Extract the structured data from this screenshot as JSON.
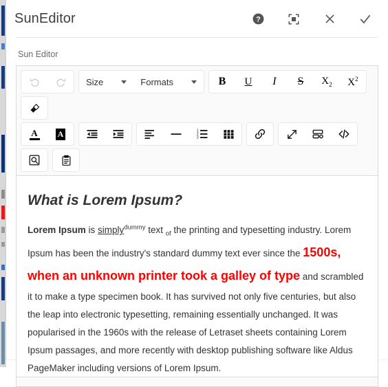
{
  "window": {
    "title": "SunEditor",
    "header_actions": [
      {
        "name": "help-icon",
        "label": "Help"
      },
      {
        "name": "fullscreen-icon",
        "label": "Full screen"
      },
      {
        "name": "close-icon",
        "label": "Close"
      },
      {
        "name": "confirm-icon",
        "label": "Submit"
      }
    ]
  },
  "field": {
    "label": "Sun Editor"
  },
  "toolbar": {
    "groups_row1": [
      {
        "name": "history-group",
        "buttons": [
          {
            "name": "undo-button",
            "icon": "undo-icon",
            "label": "Undo",
            "disabled": true
          },
          {
            "name": "redo-button",
            "icon": "redo-icon",
            "label": "Redo",
            "disabled": true
          }
        ]
      },
      {
        "name": "dropdown-group",
        "buttons": [
          {
            "name": "font-size-select",
            "icon": "chevron-down-icon",
            "label": "Size",
            "disabled": false
          },
          {
            "name": "formats-select",
            "icon": "chevron-down-icon",
            "label": "Formats",
            "disabled": false
          }
        ]
      },
      {
        "name": "text-style-group",
        "buttons": [
          {
            "name": "bold-button",
            "icon": "bold-icon",
            "label": "B",
            "disabled": false
          },
          {
            "name": "underline-button",
            "icon": "underline-icon",
            "label": "U",
            "disabled": false
          },
          {
            "name": "italic-button",
            "icon": "italic-icon",
            "label": "I",
            "disabled": false
          },
          {
            "name": "strikethrough-button",
            "icon": "strikethrough-icon",
            "label": "S",
            "disabled": false
          },
          {
            "name": "subscript-button",
            "icon": "subscript-icon",
            "label": "X",
            "sub": "2",
            "disabled": false
          },
          {
            "name": "superscript-button",
            "icon": "superscript-icon",
            "label": "X",
            "sup": "2",
            "disabled": false
          }
        ]
      },
      {
        "name": "remove-format-group",
        "buttons": [
          {
            "name": "remove-format-button",
            "icon": "eraser-icon",
            "label": "Remove Format",
            "disabled": false
          }
        ]
      }
    ],
    "groups_row2": [
      {
        "name": "color-group",
        "buttons": [
          {
            "name": "font-color-button",
            "icon": "font-color-icon",
            "label": "A",
            "disabled": false
          },
          {
            "name": "highlight-color-button",
            "icon": "highlight-color-icon",
            "label": "A",
            "disabled": false
          }
        ]
      },
      {
        "name": "indent-group",
        "buttons": [
          {
            "name": "outdent-button",
            "icon": "outdent-icon",
            "label": "Outdent",
            "disabled": false
          },
          {
            "name": "indent-button",
            "icon": "indent-icon",
            "label": "Indent",
            "disabled": false
          }
        ]
      },
      {
        "name": "block-group",
        "buttons": [
          {
            "name": "align-button",
            "icon": "align-left-icon",
            "label": "Align",
            "disabled": false
          },
          {
            "name": "horizontal-rule-button",
            "icon": "horizontal-line-icon",
            "label": "Horizontal line",
            "disabled": false
          },
          {
            "name": "list-button",
            "icon": "ordered-list-icon",
            "label": "List",
            "disabled": false
          },
          {
            "name": "table-button",
            "icon": "table-icon",
            "label": "Table",
            "disabled": false
          }
        ]
      },
      {
        "name": "link-group",
        "buttons": [
          {
            "name": "link-button",
            "icon": "link-icon",
            "label": "Link",
            "disabled": false
          }
        ]
      },
      {
        "name": "media-group",
        "buttons": [
          {
            "name": "image-button",
            "icon": "resize-arrows-icon",
            "label": "Image",
            "disabled": false
          },
          {
            "name": "video-button",
            "icon": "video-icon",
            "label": "Video",
            "disabled": false
          },
          {
            "name": "code-view-button",
            "icon": "code-icon",
            "label": "Code view",
            "disabled": false
          }
        ]
      }
    ],
    "groups_row3": [
      {
        "name": "search-group",
        "buttons": [
          {
            "name": "find-replace-button",
            "icon": "search-icon",
            "label": "Find and replace",
            "disabled": false
          }
        ]
      },
      {
        "name": "template-group",
        "buttons": [
          {
            "name": "template-button",
            "icon": "clipboard-icon",
            "label": "Template",
            "disabled": false
          }
        ]
      }
    ]
  },
  "content": {
    "heading": "What is Lorem Ipsum?",
    "paragraph": {
      "bold_lead": "Lorem Ipsum",
      "is": " is ",
      "underlined": "simply",
      "superscript": "dummy",
      "text": " text ",
      "subscript": "of",
      "after_sub": " the printing and typesetting industry. Lorem Ipsum has been the industry's standard dummy text ever since the ",
      "red_bold": "1500s, when an unknown printer took a galley of type",
      "tail": " and scrambled it to make a type specimen book. It has survived not only five centuries, but also the leap into electronic typesetting, remaining essentially unchanged. It was popularised in the 1960s with the release of Letraset sheets containing Lorem Ipsum passages, and more recently with desktop publishing software like Aldus PageMaker including versions of Lorem Ipsum."
    }
  },
  "colors": {
    "red_text": "#ff0000",
    "heading_text": "#333333",
    "body_text": "#333333",
    "toolbar_bg": "#fafafa",
    "border": "#dadada"
  }
}
